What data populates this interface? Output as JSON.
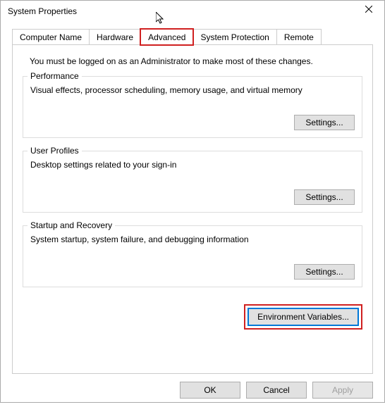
{
  "window": {
    "title": "System Properties"
  },
  "tabs": {
    "computer_name": "Computer Name",
    "hardware": "Hardware",
    "advanced": "Advanced",
    "system_protection": "System Protection",
    "remote": "Remote"
  },
  "intro": "You must be logged on as an Administrator to make most of these changes.",
  "performance": {
    "legend": "Performance",
    "desc": "Visual effects, processor scheduling, memory usage, and virtual memory",
    "button": "Settings..."
  },
  "user_profiles": {
    "legend": "User Profiles",
    "desc": "Desktop settings related to your sign-in",
    "button": "Settings..."
  },
  "startup": {
    "legend": "Startup and Recovery",
    "desc": "System startup, system failure, and debugging information",
    "button": "Settings..."
  },
  "env_button": "Environment Variables...",
  "buttons": {
    "ok": "OK",
    "cancel": "Cancel",
    "apply": "Apply"
  }
}
